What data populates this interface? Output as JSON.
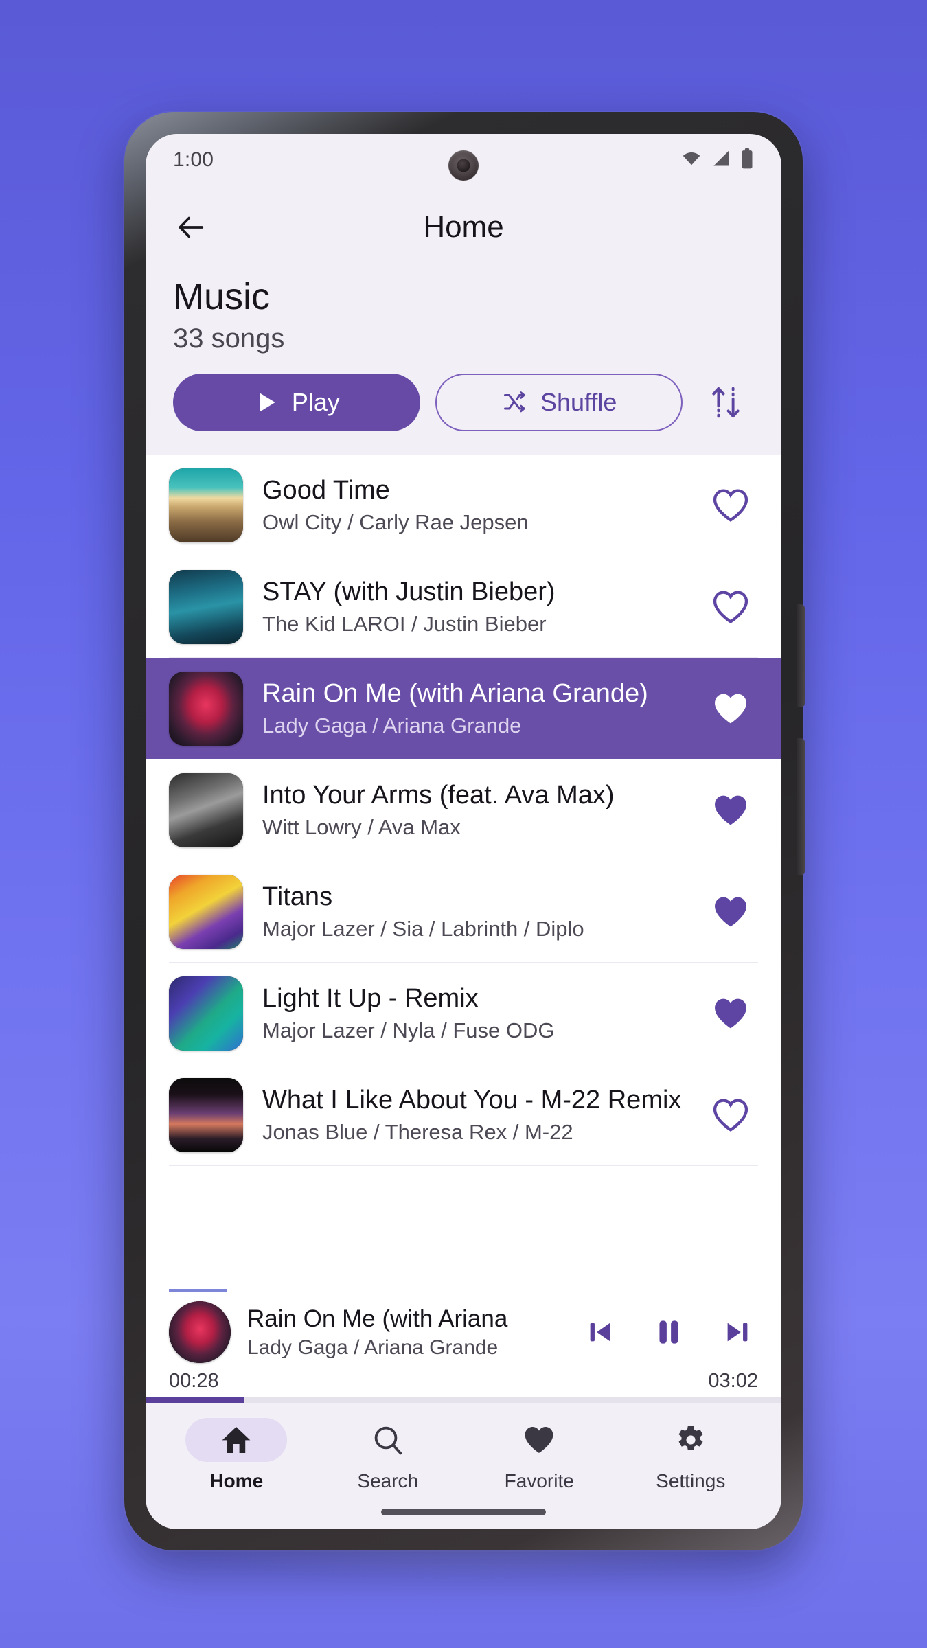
{
  "status_bar": {
    "clock": "1:00",
    "icons": [
      "wifi-icon",
      "cellular-signal-icon",
      "battery-icon"
    ]
  },
  "app_bar": {
    "back_icon": "arrow-left-icon",
    "title": "Home"
  },
  "collection": {
    "title": "Music",
    "subtitle": "33 songs",
    "play_label": "Play",
    "play_icon": "play-icon",
    "shuffle_label": "Shuffle",
    "shuffle_icon": "shuffle-icon",
    "sort_icon": "sort-updown-icon"
  },
  "colors": {
    "accent": "#664aa6",
    "accent_row": "#6a4fa8",
    "accent_outline": "#7d61bd",
    "surface": "#f3eff7",
    "list_surface": "#ffffff",
    "nav_pill": "#e3dcf2",
    "progress_fill": "#5a3f9b",
    "wallpaper": "#6366e8"
  },
  "songs": [
    {
      "title": "Good Time",
      "artist": "Owl City / Carly Rae Jepsen",
      "favorite": false,
      "active": false,
      "art": "owl-city"
    },
    {
      "title": "STAY (with Justin Bieber)",
      "artist": "The Kid LAROI / Justin Bieber",
      "favorite": false,
      "active": false,
      "art": "stay"
    },
    {
      "title": "Rain On Me (with Ariana Grande)",
      "artist": "Lady Gaga / Ariana Grande",
      "favorite": true,
      "active": true,
      "art": "rain-on-me"
    },
    {
      "title": "Into Your Arms (feat. Ava Max)",
      "artist": "Witt Lowry / Ava Max",
      "favorite": true,
      "active": false,
      "art": "into-your-arms"
    },
    {
      "title": "Titans",
      "artist": "Major Lazer / Sia / Labrinth / Diplo",
      "favorite": true,
      "active": false,
      "art": "titans"
    },
    {
      "title": "Light It Up - Remix",
      "artist": "Major Lazer / Nyla / Fuse ODG",
      "favorite": true,
      "active": false,
      "art": "light-it-up"
    },
    {
      "title": "What I Like About You - M-22 Remix",
      "artist": "Jonas Blue / Theresa Rex / M-22",
      "favorite": false,
      "active": false,
      "art": "what-i-like"
    }
  ],
  "mini_player": {
    "title": "Rain On Me (with Ariana",
    "artist": "Lady Gaga / Ariana Grande",
    "elapsed": "00:28",
    "duration": "03:02",
    "progress_percent": 15.4,
    "prev_icon": "skip-previous-icon",
    "play_pause_icon": "pause-icon",
    "next_icon": "skip-next-icon"
  },
  "bottom_nav": [
    {
      "label": "Home",
      "icon": "home-icon",
      "active": true
    },
    {
      "label": "Search",
      "icon": "search-icon",
      "active": false
    },
    {
      "label": "Favorite",
      "icon": "heart-filled-icon",
      "active": false
    },
    {
      "label": "Settings",
      "icon": "gear-icon",
      "active": false
    }
  ]
}
